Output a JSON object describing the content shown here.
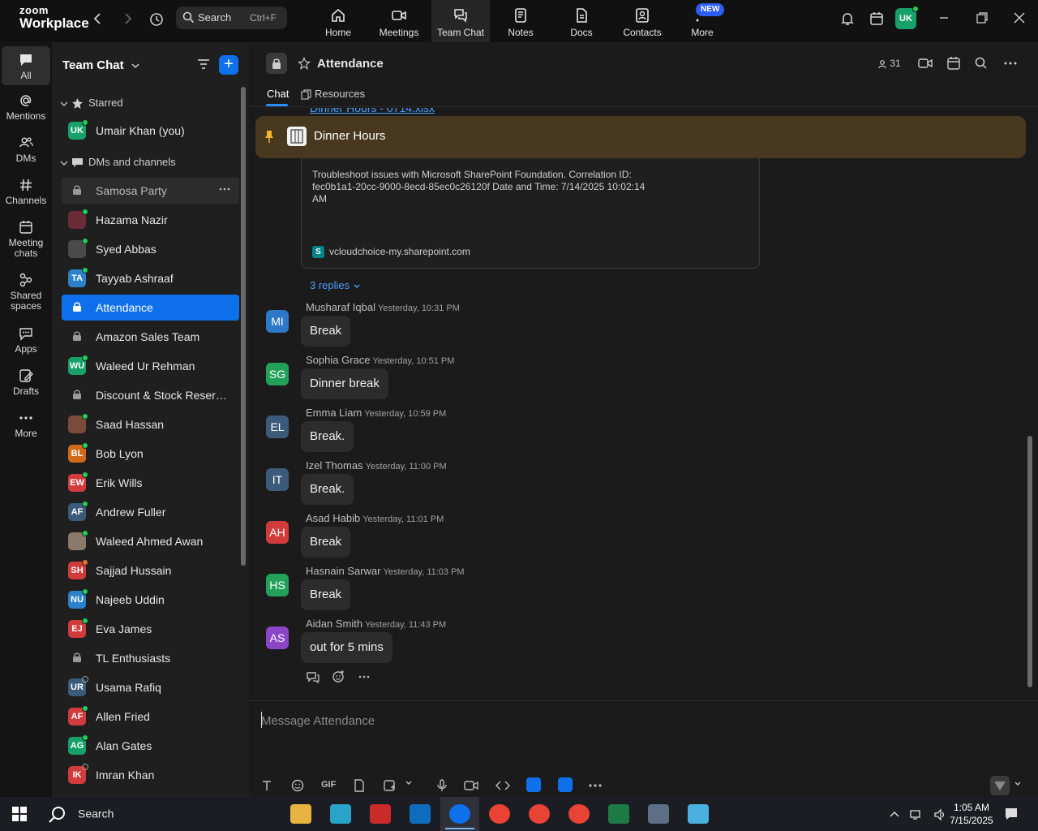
{
  "app": {
    "logo_top": "zoom",
    "logo_bottom": "Workplace"
  },
  "search": {
    "placeholder": "Search",
    "shortcut": "Ctrl+F"
  },
  "top_tabs": [
    {
      "label": "Home",
      "icon": "home-icon"
    },
    {
      "label": "Meetings",
      "icon": "video-camera-icon"
    },
    {
      "label": "Team Chat",
      "icon": "chat-bubbles-icon"
    },
    {
      "label": "Notes",
      "icon": "notes-icon"
    },
    {
      "label": "Docs",
      "icon": "docs-icon"
    },
    {
      "label": "Contacts",
      "icon": "contacts-icon"
    },
    {
      "label": "More",
      "icon": "more-dots-icon"
    }
  ],
  "new_badge": "NEW",
  "user_avatar": "UK",
  "rail": [
    {
      "label": "All",
      "icon": "chat-icon"
    },
    {
      "label": "Mentions",
      "icon": "at-icon"
    },
    {
      "label": "DMs",
      "icon": "people-icon"
    },
    {
      "label": "Channels",
      "icon": "hash-icon"
    },
    {
      "label": "Meeting chats",
      "icon": "calendar-icon"
    },
    {
      "label": "Shared spaces",
      "icon": "shared-spaces-icon"
    },
    {
      "label": "Apps",
      "icon": "apps-icon"
    },
    {
      "label": "Drafts",
      "icon": "drafts-icon"
    },
    {
      "label": "More",
      "icon": "more-dots-icon"
    }
  ],
  "sidebar": {
    "title": "Team Chat",
    "starred_label": "Starred",
    "dms_label": "DMs and channels",
    "starred": [
      {
        "name": "Umair Khan (you)",
        "initials": "UK",
        "color": "#18a06a",
        "status": "online"
      }
    ],
    "items": [
      {
        "name": "Samosa Party",
        "type": "channel",
        "state": "hover"
      },
      {
        "name": "Hazama Nazir",
        "initials": "",
        "color": "#6b2b39",
        "status": "online"
      },
      {
        "name": "Syed Abbas",
        "initials": "",
        "color": "#4a4a4a",
        "status": "online"
      },
      {
        "name": "Tayyab Ashraaf",
        "initials": "TA",
        "color": "#2b82c9",
        "status": "online"
      },
      {
        "name": "Attendance",
        "type": "channel",
        "state": "selected"
      },
      {
        "name": "Amazon Sales Team",
        "type": "channel"
      },
      {
        "name": "Waleed Ur Rehman",
        "initials": "WU",
        "color": "#18a06a",
        "status": "online"
      },
      {
        "name": "Discount & Stock Reservati...",
        "type": "channel"
      },
      {
        "name": "Saad Hassan",
        "initials": "",
        "color": "#7a4a3a",
        "status": "online"
      },
      {
        "name": "Bob Lyon",
        "initials": "BL",
        "color": "#d26a1b",
        "status": "online"
      },
      {
        "name": "Erik Wills",
        "initials": "EW",
        "color": "#d23b3b",
        "status": "online"
      },
      {
        "name": "Andrew Fuller",
        "initials": "AF",
        "color": "#3c5a7a",
        "status": "online"
      },
      {
        "name": "Waleed Ahmed Awan",
        "initials": "",
        "color": "#8a7a6a",
        "status": "online"
      },
      {
        "name": "Sajjad Hussain",
        "initials": "SH",
        "color": "#d23b3b",
        "status": "busy"
      },
      {
        "name": "Najeeb Uddin",
        "initials": "NU",
        "color": "#2b82c9",
        "status": "online"
      },
      {
        "name": "Eva James",
        "initials": "EJ",
        "color": "#d23b3b",
        "status": "online"
      },
      {
        "name": "TL Enthusiasts",
        "type": "channel"
      },
      {
        "name": "Usama Rafiq",
        "initials": "UR",
        "color": "#3c5a7a",
        "status": "offline"
      },
      {
        "name": "Allen Fried",
        "initials": "AF",
        "color": "#d23b3b",
        "status": "online"
      },
      {
        "name": "Alan Gates",
        "initials": "AG",
        "color": "#18a06a",
        "status": "online"
      },
      {
        "name": "Imran Khan",
        "initials": "IK",
        "color": "#d23b3b",
        "status": "offline"
      }
    ]
  },
  "chat": {
    "title": "Attendance",
    "member_count": "31",
    "tabs": [
      "Chat",
      "Resources"
    ],
    "cut_link": "Dinner Hours - 0714.xlsx",
    "pinned_title": "Dinner Hours",
    "link_preview_text": "Troubleshoot issues with Microsoft SharePoint Foundation. Correlation ID: fec0b1a1-20cc-9000-8ecd-85ec0c26120f Date and Time: 7/14/2025 10:02:14 AM",
    "link_preview_source": "vcloudchoice-my.sharepoint.com",
    "replies": "3 replies",
    "messages": [
      {
        "initials": "MI",
        "color": "#2e78c8",
        "author": "Musharaf Iqbal",
        "time": "Yesterday, 10:31 PM",
        "text": "Break"
      },
      {
        "initials": "SG",
        "color": "#23a05a",
        "author": "Sophia Grace",
        "time": "Yesterday, 10:51 PM",
        "text": "Dinner break"
      },
      {
        "initials": "EL",
        "color": "#3c5a7a",
        "author": "Emma Liam",
        "time": "Yesterday, 10:59 PM",
        "text": "Break."
      },
      {
        "initials": "IT",
        "color": "#3c5a7a",
        "author": "Izel Thomas",
        "time": "Yesterday, 11:00 PM",
        "text": "Break."
      },
      {
        "initials": "AH",
        "color": "#d23b3b",
        "author": "Asad Habib",
        "time": "Yesterday, 11:01 PM",
        "text": "Break"
      },
      {
        "initials": "HS",
        "color": "#23a05a",
        "author": "Hasnain Sarwar",
        "time": "Yesterday, 11:03 PM",
        "text": "Break"
      },
      {
        "initials": "AS",
        "color": "#8a45c8",
        "author": "Aidan Smith",
        "time": "Yesterday, 11:43 PM",
        "text": "out for 5 mins"
      }
    ],
    "composer_placeholder": "Message Attendance",
    "gif_label": "GIF"
  },
  "taskbar": {
    "search": "Search",
    "time": "1:05 AM",
    "date": "7/15/2025",
    "apps": [
      {
        "name": "file-explorer",
        "color": "#e8b341"
      },
      {
        "name": "app-blue",
        "color": "#2aa3c9"
      },
      {
        "name": "filezilla",
        "color": "#c92a2a"
      },
      {
        "name": "outlook",
        "color": "#0f6cbd"
      },
      {
        "name": "zoom",
        "color": "#0e71eb"
      },
      {
        "name": "chrome-1",
        "color": "#e94335"
      },
      {
        "name": "chrome-2",
        "color": "#e94335"
      },
      {
        "name": "chrome-3",
        "color": "#e94335"
      },
      {
        "name": "excel",
        "color": "#1d7a45"
      },
      {
        "name": "calculator",
        "color": "#5c6f85"
      },
      {
        "name": "notepad",
        "color": "#4ab0e0"
      }
    ]
  }
}
